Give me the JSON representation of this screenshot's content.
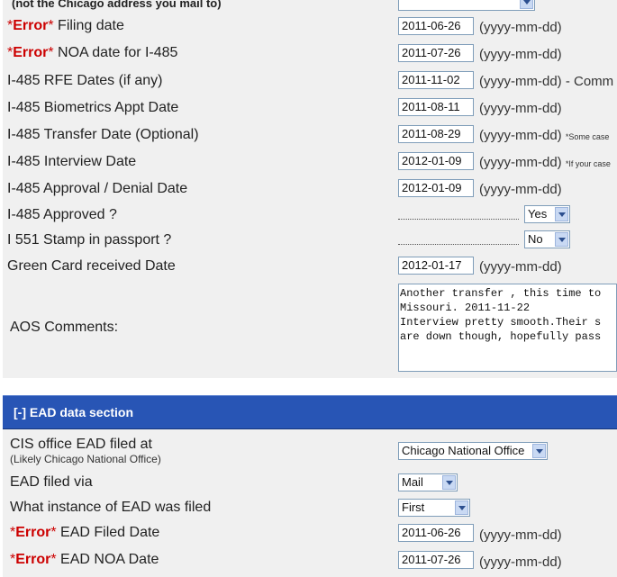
{
  "aos": {
    "top_note": "(not the Chicago address you mail to)",
    "error_word": "Error",
    "star": "*",
    "filing_date_label": "Filing date",
    "filing_date_value": "2011-06-26",
    "noa_label": "NOA date for I-485",
    "noa_value": "2011-07-26",
    "rfe_label": "I-485 RFE Dates (if any)",
    "rfe_value": "2011-11-02",
    "rfe_hint": "(yyyy-mm-dd) - Comm",
    "bio_label": "I-485 Biometrics Appt Date",
    "bio_value": "2011-08-11",
    "transfer_label": "I-485 Transfer Date (Optional)",
    "transfer_value": "2011-08-29",
    "transfer_note": "*Some case",
    "interview_label": "I-485 Interview Date",
    "interview_value": "2012-01-09",
    "interview_note": "*If your case",
    "approval_label": "I-485 Approval / Denial Date",
    "approval_value": "2012-01-09",
    "approved_label": "I-485 Approved ?",
    "approved_value": "Yes",
    "stamp_label": "I 551 Stamp in passport ?",
    "stamp_value": "No",
    "gc_label": "Green Card received Date",
    "gc_value": "2012-01-17",
    "comments_label": "AOS Comments:",
    "comments_value": "Another transfer , this time to\nMissouri. 2011-11-22\nInterview pretty smooth.Their s\nare down though, hopefully pass",
    "date_hint": "(yyyy-mm-dd)"
  },
  "ead": {
    "section_title": "[-] EAD data section",
    "office_label": "CIS office EAD filed at",
    "office_sublabel": "(Likely Chicago National Office)",
    "office_value": "Chicago National Office",
    "via_label": "EAD filed via",
    "via_value": "Mail",
    "instance_label": "What instance of EAD was filed",
    "instance_value": "First",
    "filed_label": "EAD Filed Date",
    "filed_value": "2011-06-26",
    "noa_label": "EAD NOA Date",
    "noa_value": "2011-07-26",
    "date_hint": "(yyyy-mm-dd)"
  }
}
